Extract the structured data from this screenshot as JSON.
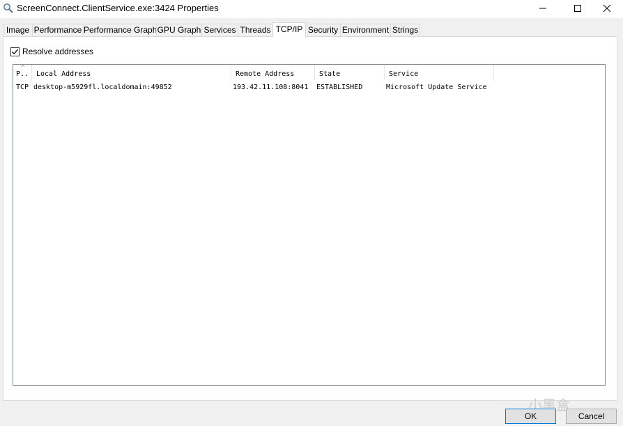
{
  "window": {
    "title": "ScreenConnect.ClientService.exe:3424 Properties",
    "icon": "magnifier-icon",
    "controls": {
      "minimize": "minimize-icon",
      "maximize": "maximize-icon",
      "close": "close-icon"
    }
  },
  "tabs": [
    {
      "label": "Image",
      "active": false
    },
    {
      "label": "Performance",
      "active": false
    },
    {
      "label": "Performance Graph",
      "active": false
    },
    {
      "label": "GPU Graph",
      "active": false
    },
    {
      "label": "Services",
      "active": false
    },
    {
      "label": "Threads",
      "active": false
    },
    {
      "label": "TCP/IP",
      "active": true
    },
    {
      "label": "Security",
      "active": false
    },
    {
      "label": "Environment",
      "active": false
    },
    {
      "label": "Strings",
      "active": false
    }
  ],
  "resolve": {
    "label": "Resolve addresses",
    "checked": true
  },
  "table": {
    "columns": [
      "P..",
      "Local Address",
      "Remote Address",
      "State",
      "Service"
    ],
    "sort_indicator": "^",
    "rows": [
      [
        "TCP",
        "desktop-m5929fl.localdomain:49852",
        "193.42.11.108:8041",
        "ESTABLISHED",
        "Microsoft Update Service"
      ]
    ]
  },
  "buttons": {
    "ok": "OK",
    "cancel": "Cancel"
  },
  "watermark": "小黑盒",
  "colors": {
    "ok_border": "#0078d7",
    "active_tab": "#ffffff"
  }
}
